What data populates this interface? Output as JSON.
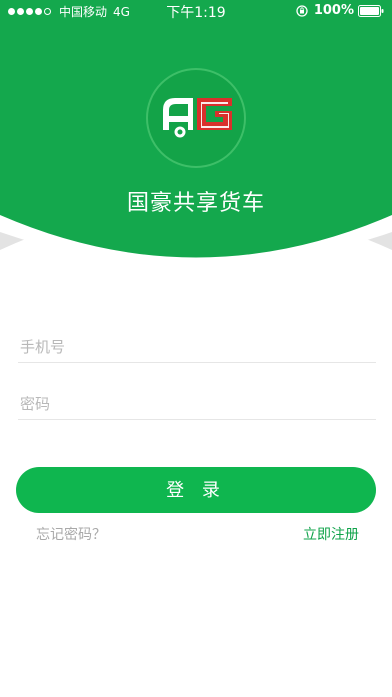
{
  "status_bar": {
    "carrier": "中国移动",
    "network": "4G",
    "time": "下午1:19",
    "battery": "100%"
  },
  "app": {
    "title": "国豪共享货车",
    "logo_text": "AG"
  },
  "form": {
    "phone_placeholder": "手机号",
    "password_placeholder": "密码",
    "login_label": "登 录",
    "forgot_label": "忘记密码？",
    "register_label": "立即注册"
  },
  "colors": {
    "brand_green": "#13a348",
    "button_green": "#0fb64f",
    "logo_red": "#d9302c"
  }
}
